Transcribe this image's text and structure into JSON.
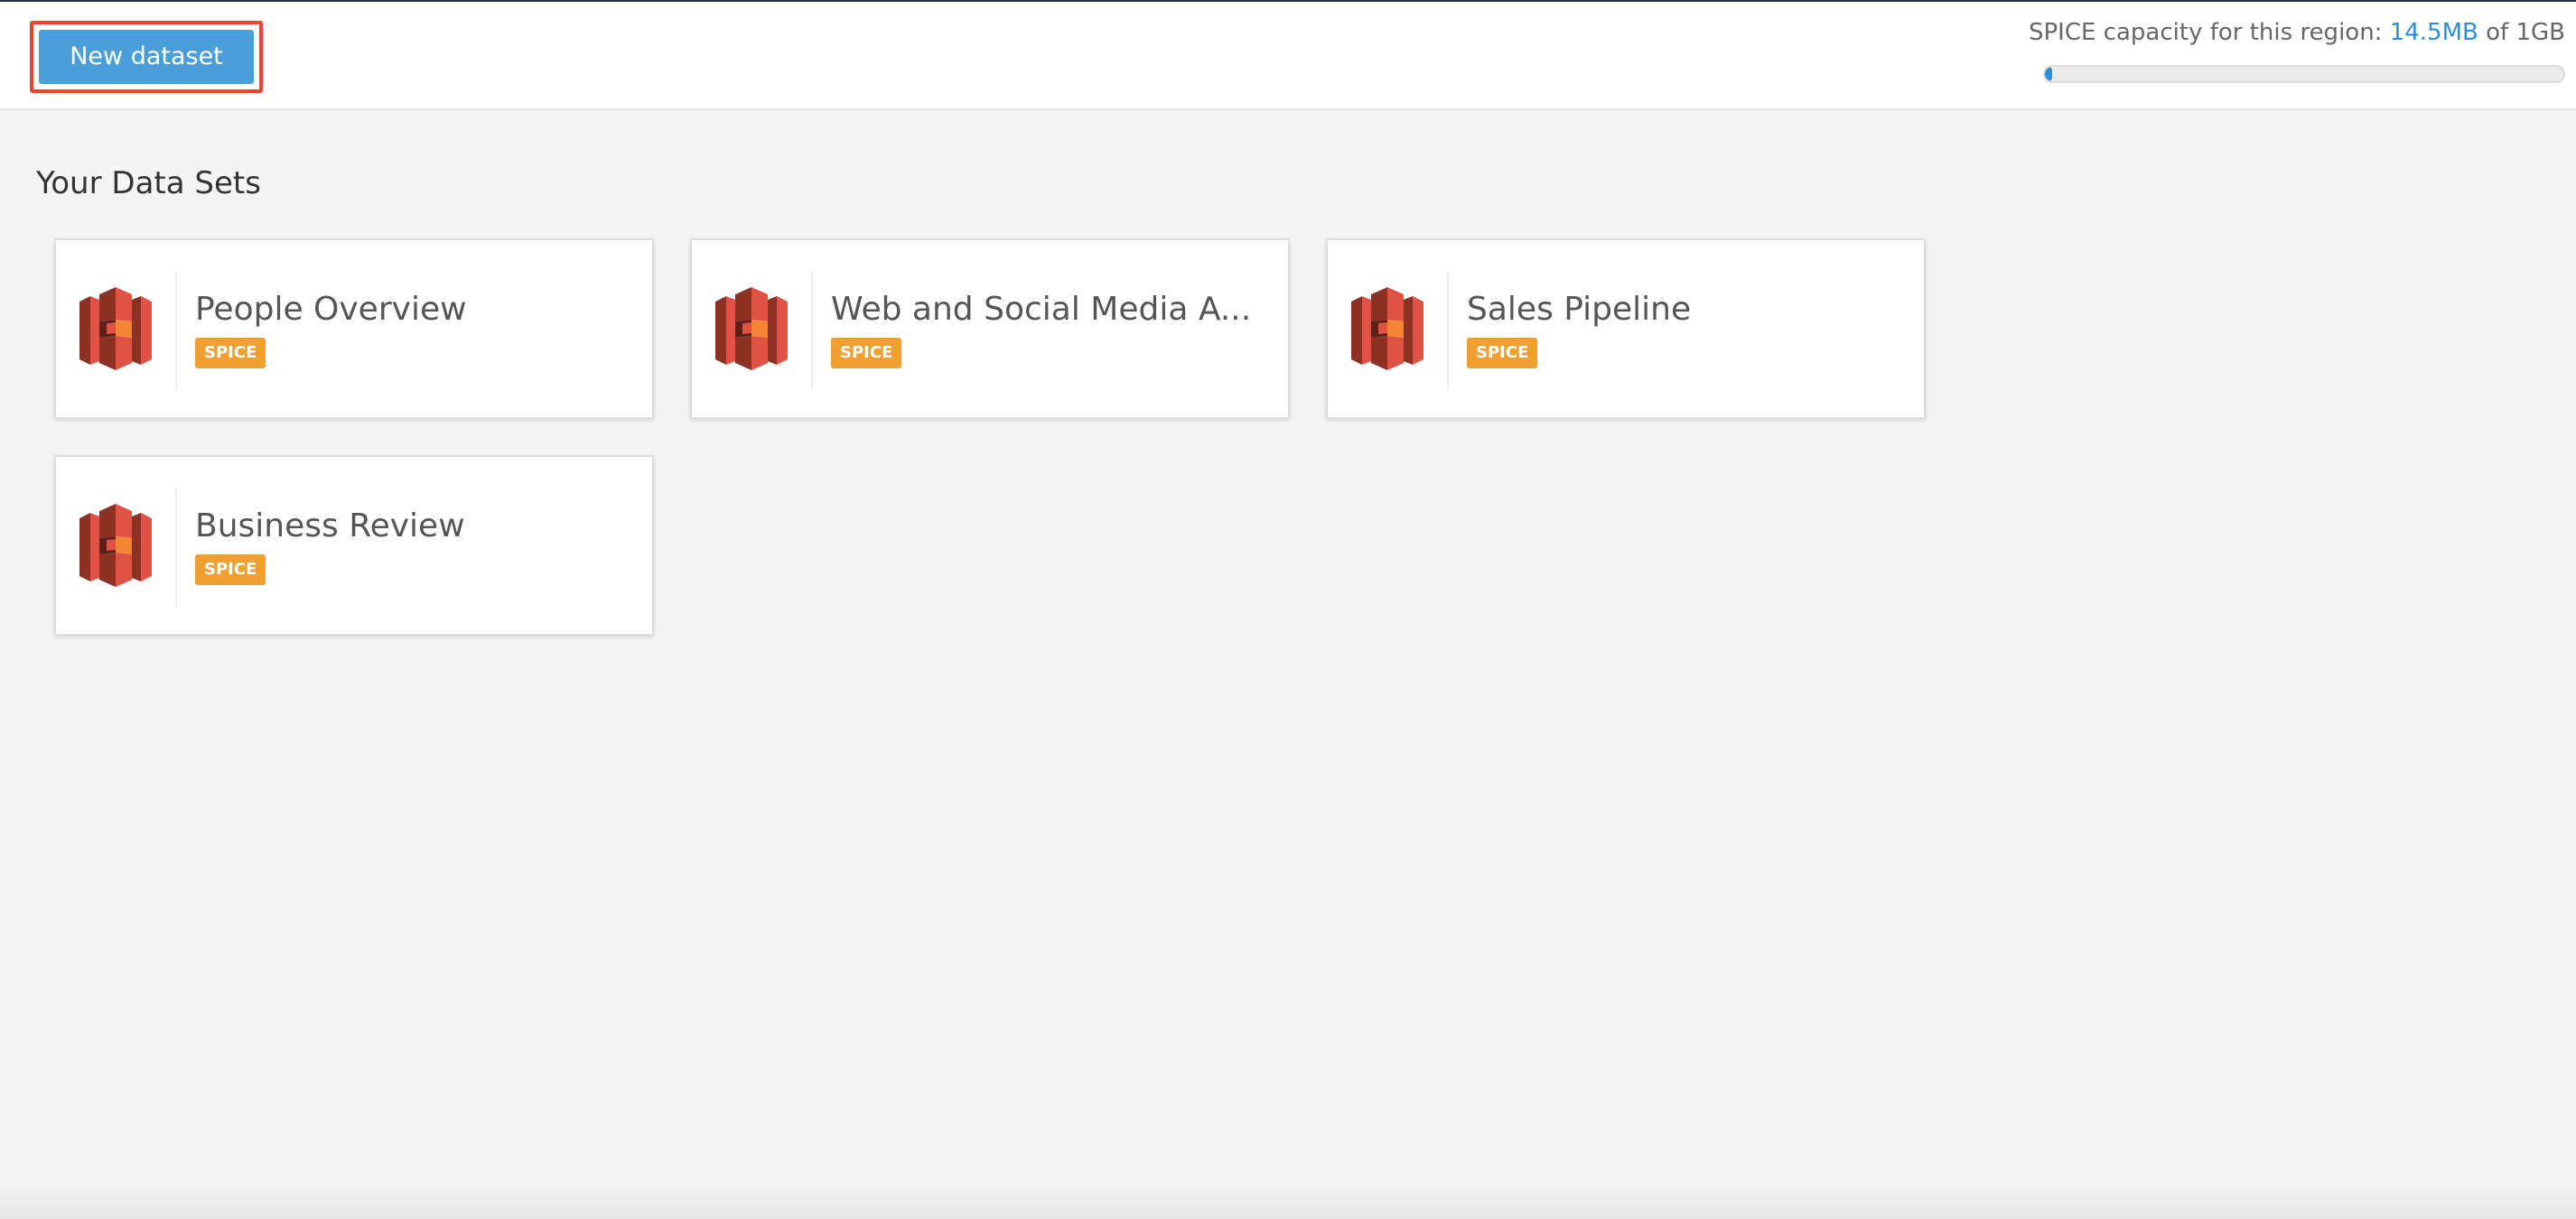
{
  "toolbar": {
    "new_dataset_label": "New dataset"
  },
  "capacity": {
    "label": "SPICE capacity for this region: ",
    "used": "14.5MB",
    "separator": " of ",
    "total": "1GB",
    "used_fraction": 0.0142
  },
  "main": {
    "section_title": "Your Data Sets",
    "datasets": [
      {
        "name": "People Overview",
        "badge": "SPICE",
        "icon": "s3-bucket-icon"
      },
      {
        "name": "Web and Social Media A...",
        "badge": "SPICE",
        "icon": "s3-bucket-icon"
      },
      {
        "name": "Sales Pipeline",
        "badge": "SPICE",
        "icon": "s3-bucket-icon"
      },
      {
        "name": "Business Review",
        "badge": "SPICE",
        "icon": "s3-bucket-icon"
      }
    ]
  },
  "colors": {
    "primary_button": "#4a9fd8",
    "highlight_border": "#e8452e",
    "badge": "#f0a033",
    "icon": "#d9523f",
    "accent_text": "#2e8fd6"
  }
}
